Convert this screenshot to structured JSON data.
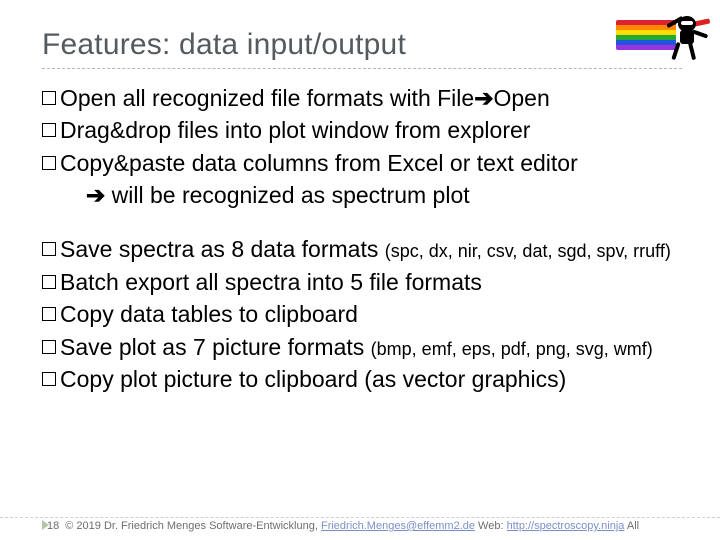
{
  "title": "Features: data input/output",
  "bullets_top": [
    {
      "lead": "Open",
      "rest": " all recognized file formats with File",
      "tail": "Open"
    },
    {
      "lead": "Drag&drop",
      "rest": " files into plot window from explorer",
      "tail": ""
    },
    {
      "lead": "Copy&paste",
      "rest": " data columns from Excel or text editor",
      "tail": ""
    }
  ],
  "indent_line": {
    "arrow": "➔",
    "text": " will be recognized as spectrum plot"
  },
  "bullets_bottom": [
    {
      "lead": "Save",
      "rest": " spectra as 8 data formats ",
      "small": "(spc, dx, nir, csv, dat, sgd, spv, rruff)"
    },
    {
      "lead": "Batch",
      "rest": " export all spectra into 5 file formats",
      "small": ""
    },
    {
      "lead": "Copy",
      "rest": " data tables to clipboard",
      "small": ""
    },
    {
      "lead": "Save",
      "rest": " plot as 7 picture formats ",
      "small": "(bmp, emf, eps, pdf, png, svg, wmf)"
    },
    {
      "lead": "Copy",
      "rest": " plot picture to clipboard (as vector graphics)",
      "small": ""
    }
  ],
  "arrow_glyph": "➔",
  "footer": {
    "page": "18",
    "copyright": "© 2019   Dr. Friedrich Menges Software-Entwicklung, ",
    "email": "Friedrich.Menges@effemm2.de",
    "mid": "  Web: ",
    "web": "http://spectroscopy.ninja",
    "tail": "  All"
  }
}
